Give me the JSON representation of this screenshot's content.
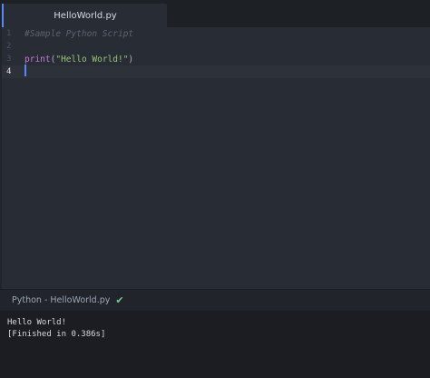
{
  "tabs": [
    {
      "label": "HelloWorld.py",
      "active": true
    }
  ],
  "editor": {
    "lines": [
      {
        "number": "1",
        "text": "#Sample Python Script"
      },
      {
        "number": "2",
        "text": ""
      },
      {
        "number": "3",
        "func": "print",
        "open": "(",
        "string": "\"Hello World!\"",
        "close": ")"
      },
      {
        "number": "4",
        "text": ""
      }
    ],
    "active_line": 4
  },
  "status": {
    "build_label": "Python - HelloWorld.py",
    "check_icon": "check-icon"
  },
  "output": {
    "lines": [
      "Hello World!",
      "[Finished in 0.386s]"
    ]
  },
  "colors": {
    "accent": "#568af2",
    "comment": "#5c6370",
    "function": "#c678dd",
    "string": "#98c379",
    "success": "#73c990"
  }
}
